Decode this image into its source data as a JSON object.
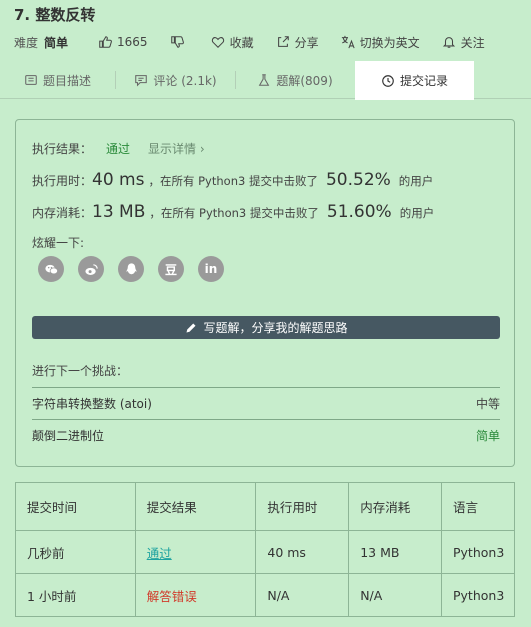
{
  "problem": {
    "title": "7. 整数反转",
    "difficulty_label": "难度",
    "difficulty_value": "简单",
    "likes": "1665",
    "collect": "收藏",
    "share": "分享",
    "switch_lang": "切换为英文",
    "follow": "关注"
  },
  "tabs": [
    {
      "label": "题目描述",
      "icon": "document-icon"
    },
    {
      "label": "评论 (2.1k)",
      "icon": "comment-icon"
    },
    {
      "label": "题解(809)",
      "icon": "flask-icon"
    },
    {
      "label": "提交记录",
      "icon": "clock-icon"
    }
  ],
  "result": {
    "status_label": "执行结果：",
    "status_value": "通过",
    "details_link": "显示详情 ›",
    "time_label": "执行用时：",
    "time_value": "40 ms",
    "time_text": "，在所有 Python3 提交中击败了",
    "time_pct": "50.52%",
    "users": "的用户",
    "mem_label": "内存消耗：",
    "mem_value": "13 MB",
    "mem_text": "，在所有 Python3 提交中击败了",
    "mem_pct": "51.60%",
    "share_label": "炫耀一下:",
    "write_btn": "写题解，分享我的解题思路",
    "next_label": "进行下一个挑战：",
    "next": [
      {
        "name": "字符串转换整数 (atoi)",
        "level": "中等"
      },
      {
        "name": "颠倒二进制位",
        "level": "简单"
      }
    ],
    "share_icons": [
      "wechat-icon",
      "weibo-icon",
      "qq-icon",
      "douban-icon",
      "linkedin-icon"
    ],
    "douban_glyph": "豆",
    "linkedin_glyph": "in"
  },
  "submissions": {
    "headers": [
      "提交时间",
      "提交结果",
      "执行用时",
      "内存消耗",
      "语言"
    ],
    "rows": [
      [
        "几秒前",
        "通过",
        "40 ms",
        "13 MB",
        "Python3"
      ],
      [
        "1 小时前",
        "解答错误",
        "N/A",
        "N/A",
        "Python3"
      ]
    ]
  }
}
